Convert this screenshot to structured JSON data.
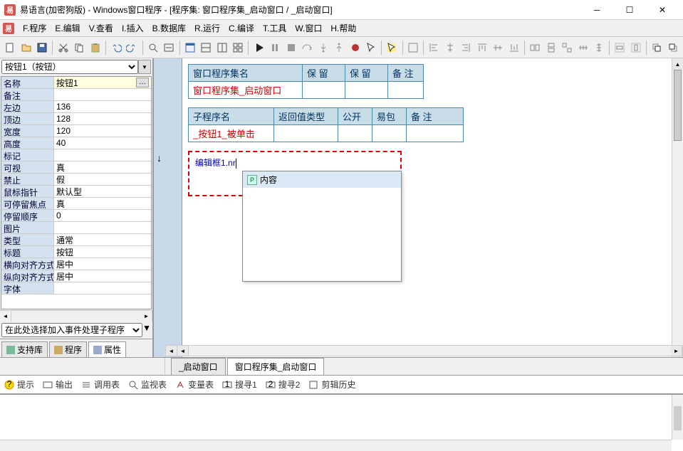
{
  "window": {
    "title": "易语言(加密狗版) - Windows窗口程序 - [程序集: 窗口程序集_启动窗口 / _启动窗口]"
  },
  "menu": {
    "file": "F.程序",
    "edit": "E.编辑",
    "view": "V.查看",
    "insert": "I.插入",
    "db": "B.数据库",
    "run": "R.运行",
    "compile": "C.编译",
    "tools": "T.工具",
    "window": "W.窗口",
    "help": "H.帮助"
  },
  "prop_combo": {
    "selected": "按钮1（按钮）"
  },
  "properties": [
    {
      "k": "名称",
      "v": "按钮1",
      "hl": true,
      "dots": true
    },
    {
      "k": "备注",
      "v": ""
    },
    {
      "k": "左边",
      "v": "136"
    },
    {
      "k": "顶边",
      "v": "128"
    },
    {
      "k": "宽度",
      "v": "120"
    },
    {
      "k": "高度",
      "v": "40"
    },
    {
      "k": "标记",
      "v": ""
    },
    {
      "k": "可视",
      "v": "真"
    },
    {
      "k": "禁止",
      "v": "假"
    },
    {
      "k": "鼠标指针",
      "v": "默认型"
    },
    {
      "k": "可停留焦点",
      "v": "真"
    },
    {
      "k": "  停留顺序",
      "v": "0"
    },
    {
      "k": "图片",
      "v": ""
    },
    {
      "k": "类型",
      "v": "通常"
    },
    {
      "k": "标题",
      "v": "按钮"
    },
    {
      "k": "横向对齐方式",
      "v": "居中"
    },
    {
      "k": "纵向对齐方式",
      "v": "居中"
    },
    {
      "k": "字体",
      "v": ""
    }
  ],
  "event_combo": {
    "placeholder": "在此处选择加入事件处理子程序"
  },
  "sidebar_tabs": {
    "t1": "支持库",
    "t2": "程序",
    "t3": "属性"
  },
  "code": {
    "tbl1": {
      "h1": "窗口程序集名",
      "h2": "保  留",
      "h3": "保  留",
      "h4": "备  注",
      "r1": "窗口程序集_启动窗口"
    },
    "tbl2": {
      "h1": "子程序名",
      "h2": "返回值类型",
      "h3": "公开",
      "h4": "易包",
      "h5": "备  注",
      "r1": "_按钮1_被单击"
    },
    "edit": {
      "obj": "编辑框1",
      "typed": "nr"
    },
    "autocomplete": {
      "item1": "内容"
    }
  },
  "doctabs": {
    "t1": "_启动窗口",
    "t2": "窗口程序集_启动窗口"
  },
  "tooltabs": {
    "t1": "提示",
    "t2": "输出",
    "t3": "调用表",
    "t4": "监视表",
    "t5": "变量表",
    "t6": "搜寻1",
    "t7": "搜寻2",
    "t8": "剪辑历史"
  }
}
